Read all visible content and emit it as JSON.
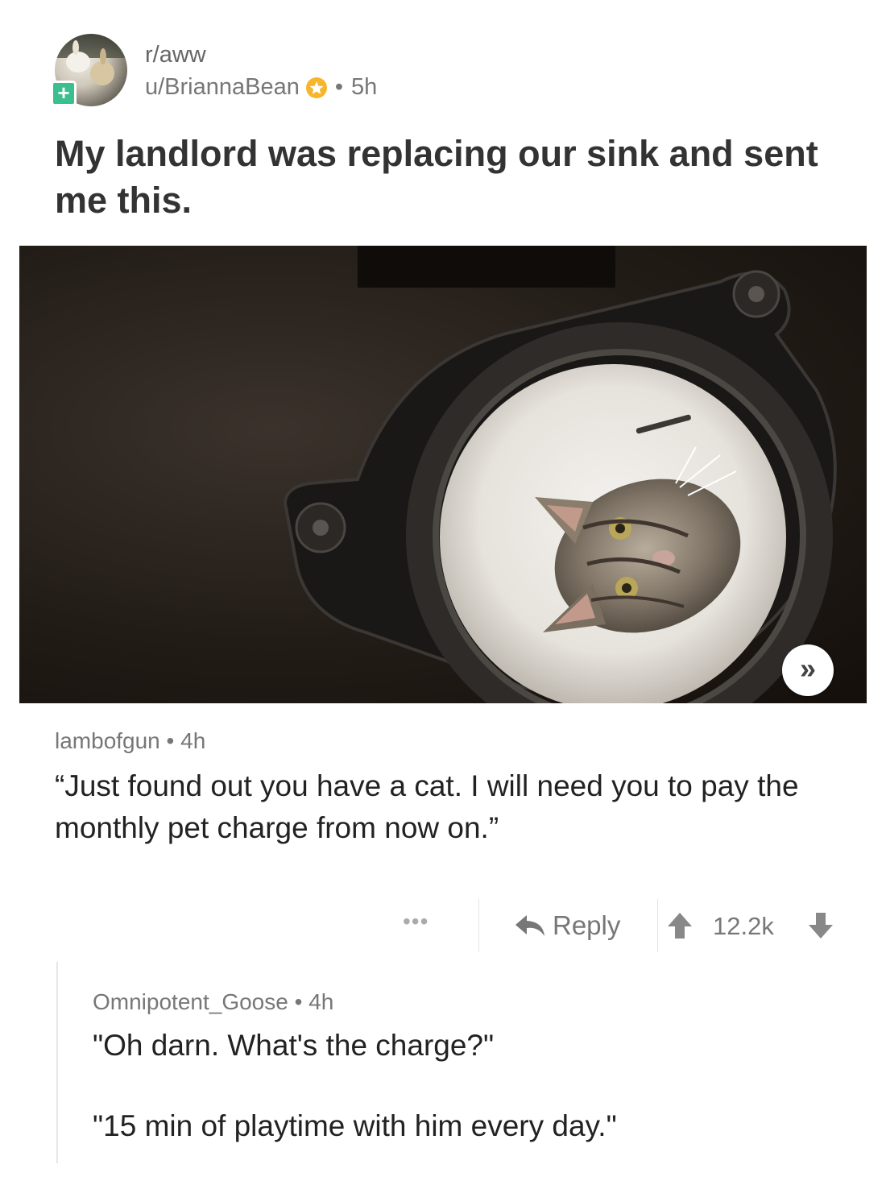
{
  "post": {
    "subreddit": "r/aww",
    "author": "u/BriannaBean",
    "age": "5h",
    "separator": "•",
    "title": "My landlord was replacing our sink and sent me this.",
    "expand_glyph": "»"
  },
  "comments": [
    {
      "author": "lambofgun",
      "age": "4h",
      "body": "“Just found out you have a cat.  I will need you to pay the monthly pet charge from now on.”",
      "actions": {
        "more": "•••",
        "reply": "Reply",
        "score": "12.2k"
      }
    },
    {
      "author": "Omnipotent_Goose",
      "age": "4h",
      "body_line1": "\"Oh darn. What's the charge?\"",
      "body_line2": "\"15 min of playtime with him every day.\""
    }
  ],
  "colors": {
    "plus_badge": "#3bbf8e",
    "gold_star": "#f7b52c",
    "meta_text": "#777777",
    "title_text": "#333333"
  },
  "icons": [
    "user-avatar",
    "plus-icon",
    "gold-star-icon",
    "expand-icon",
    "more-icon",
    "reply-arrow-icon",
    "upvote-arrow-icon",
    "downvote-arrow-icon"
  ]
}
